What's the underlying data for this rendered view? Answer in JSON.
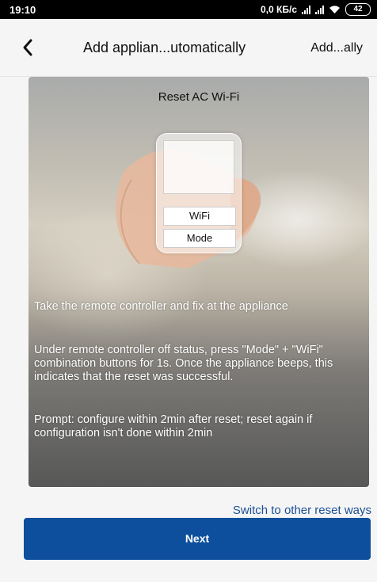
{
  "status_bar": {
    "time": "19:10",
    "network_speed": "0,0 КБ/с",
    "battery": "42"
  },
  "nav": {
    "title": "Add applian...utomatically",
    "action": "Add...ally",
    "back_icon": "chevron-left-icon"
  },
  "card": {
    "title": "Reset AC Wi-Fi",
    "remote_buttons": {
      "wifi": "WiFi",
      "mode": "Mode"
    },
    "instructions": {
      "step1": "Take the remote controller and fix at the appliance",
      "step2": "Under remote controller off status, press \"Mode\" + \"WiFi\" combination buttons for 1s. Once the appliance beeps, this indicates that the reset was successful.",
      "prompt": "Prompt: configure within 2min after reset; reset again if configuration isn't done within 2min"
    }
  },
  "switch_link": "Switch to other reset ways",
  "next_button": "Next",
  "colors": {
    "primary": "#0d4f9c",
    "link": "#1d4f96",
    "background": "#f5f5f5"
  }
}
